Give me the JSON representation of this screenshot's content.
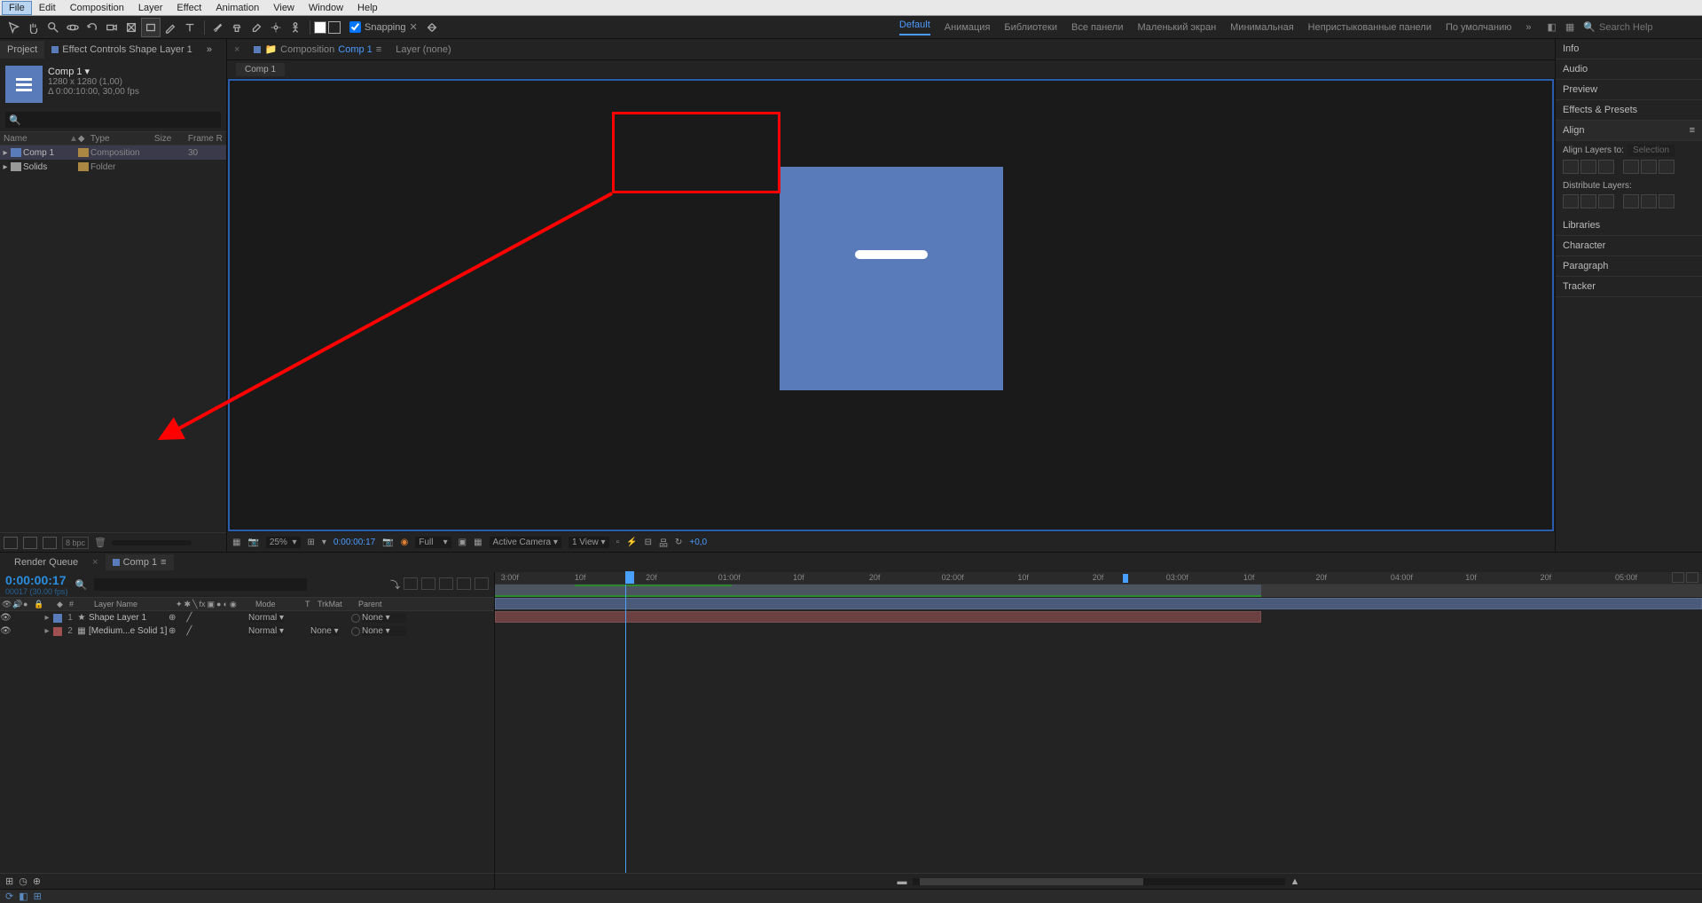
{
  "menu": {
    "items": [
      "File",
      "Edit",
      "Composition",
      "Layer",
      "Effect",
      "Animation",
      "View",
      "Window",
      "Help"
    ],
    "selected": 0
  },
  "toolbar": {
    "snapping_label": "Snapping",
    "workspaces": [
      "Default",
      "Анимация",
      "Библиотеки",
      "Все панели",
      "Маленький экран",
      "Минимальная",
      "Непристыкованные панели",
      "По умолчанию"
    ],
    "active_ws": 0,
    "search_ph": "Search Help"
  },
  "project": {
    "panel_label": "Project",
    "fx_panel_label": "Effect Controls Shape Layer 1",
    "comp": {
      "name": "Comp 1",
      "dims": "1280 x 1280 (1,00)",
      "dur": "Δ 0:00:10:00, 30,00 fps"
    },
    "cols": [
      "Name",
      "Type",
      "Size",
      "Frame R"
    ],
    "items": [
      {
        "name": "Comp 1",
        "type": "Composition",
        "fr": "30",
        "kind": "comp"
      },
      {
        "name": "Solids",
        "type": "Folder",
        "fr": "",
        "kind": "folder"
      }
    ],
    "bpc": "8 bpc"
  },
  "comp_panel": {
    "crumb_prefix": "Composition",
    "crumb_name": "Comp 1",
    "layer_label": "Layer (none)",
    "subtab": "Comp 1",
    "zoom": "25%",
    "time": "0:00:00:17",
    "res": "Full",
    "camera": "Active Camera",
    "view": "1 View",
    "expo": "+0,0"
  },
  "right_panels": {
    "items": [
      "Info",
      "Audio",
      "Preview",
      "Effects & Presets",
      "Align",
      "Libraries",
      "Character",
      "Paragraph",
      "Tracker"
    ],
    "align": {
      "label": "Align",
      "align_to_label": "Align Layers to:",
      "align_to_val": "Selection",
      "dist_label": "Distribute Layers:"
    }
  },
  "timeline": {
    "rq_label": "Render Queue",
    "comp_tab": "Comp 1",
    "timecode": "0:00:00:17",
    "frame_small": "00017 (30.00 fps)",
    "cols": {
      "num": "#",
      "name": "Layer Name",
      "mode": "Mode",
      "t": "T",
      "tm": "TrkMat",
      "par": "Parent"
    },
    "layers": [
      {
        "num": "1",
        "name": "Shape Layer 1",
        "mode": "Normal",
        "tm": "",
        "parent": "None",
        "color": "blue",
        "icon": "★"
      },
      {
        "num": "2",
        "name": "[Medium...e Solid 1]",
        "mode": "Normal",
        "tm": "None",
        "parent": "None",
        "color": "red",
        "icon": "▦"
      }
    ],
    "ruler": [
      "3:00f",
      "10f",
      "20f",
      "01:00f",
      "10f",
      "20f",
      "02:00f",
      "10f",
      "20f",
      "03:00f",
      "10f",
      "20f",
      "04:00f",
      "10f",
      "20f",
      "05:00f"
    ],
    "playhead_pct": 10.8,
    "work_end_pct": 52.0,
    "comp_end_pct": 63.5
  }
}
